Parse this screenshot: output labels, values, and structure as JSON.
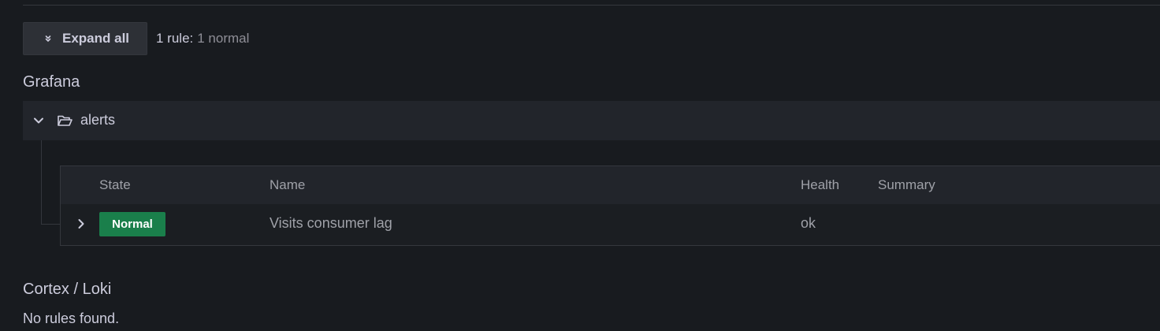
{
  "toolbar": {
    "expand_all_label": "Expand all",
    "rule_count": "1 rule:",
    "rule_detail": "1 normal"
  },
  "grafana_section": {
    "title": "Grafana",
    "folder": {
      "name": "alerts",
      "expanded": true
    },
    "table": {
      "columns": [
        "State",
        "Name",
        "Health",
        "Summary"
      ],
      "rows": [
        {
          "state": "Normal",
          "state_color": "#1a7f4b",
          "name": "Visits consumer lag",
          "health": "ok",
          "summary": ""
        }
      ]
    }
  },
  "cortex_section": {
    "title": "Cortex / Loki",
    "empty_message": "No rules found."
  },
  "icons": {
    "expand_all": "angle-double-down-icon",
    "folder_toggle": "chevron-down-icon",
    "folder": "folder-open-icon",
    "row_toggle": "chevron-right-icon"
  }
}
